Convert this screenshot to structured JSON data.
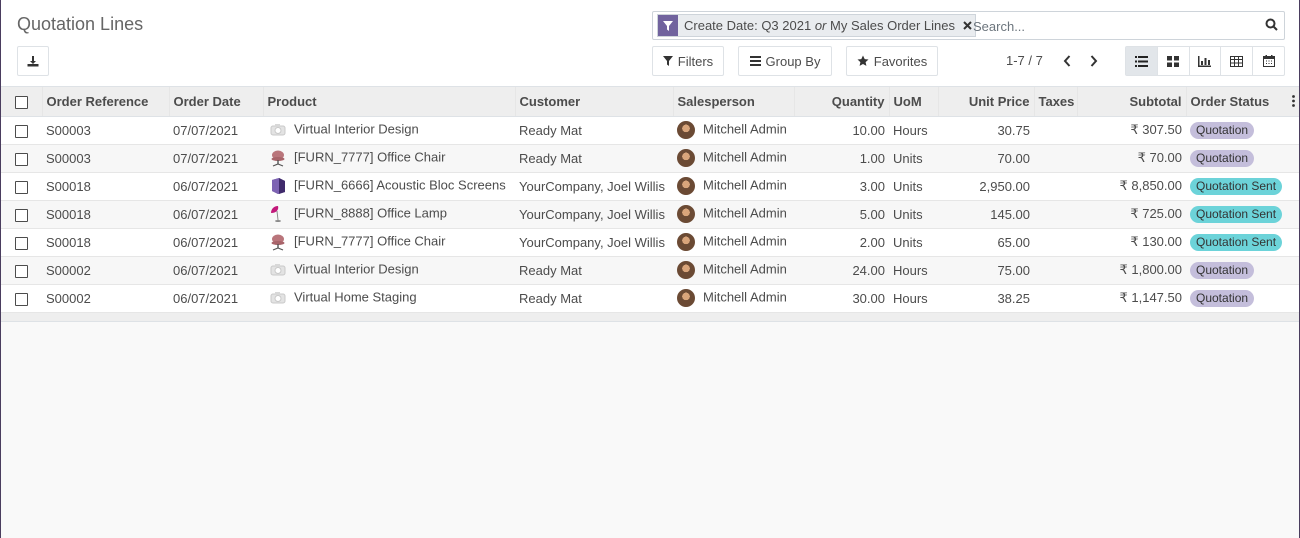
{
  "page": {
    "title": "Quotation Lines"
  },
  "search": {
    "facet": {
      "text_a": "Create Date: Q3 2021",
      "or_word": "or",
      "text_b": "My Sales Order Lines"
    },
    "placeholder": "Search..."
  },
  "toolbar": {
    "filters_label": "Filters",
    "group_by_label": "Group By",
    "favorites_label": "Favorites"
  },
  "pager": {
    "value": "1-7 / 7"
  },
  "views": [
    "list-icon",
    "kanban-icon",
    "graph-icon",
    "pivot-icon",
    "calendar-icon"
  ],
  "table": {
    "columns": {
      "order_reference": "Order Reference",
      "order_date": "Order Date",
      "product": "Product",
      "customer": "Customer",
      "salesperson": "Salesperson",
      "quantity": "Quantity",
      "uom": "UoM",
      "unit_price": "Unit Price",
      "taxes": "Taxes",
      "subtotal": "Subtotal",
      "order_status": "Order Status"
    },
    "rows": [
      {
        "ref": "S00003",
        "date": "07/07/2021",
        "product": "Virtual Interior Design",
        "product_icon": "service-camera-icon",
        "customer": "Ready Mat",
        "salesperson": "Mitchell Admin",
        "qty": "10.00",
        "uom": "Hours",
        "price": "30.75",
        "taxes": "",
        "subtotal": "₹ 307.50",
        "status": "Quotation",
        "status_kind": "quotation"
      },
      {
        "ref": "S00003",
        "date": "07/07/2021",
        "product": "[FURN_7777] Office Chair",
        "product_icon": "office-chair-icon",
        "customer": "Ready Mat",
        "salesperson": "Mitchell Admin",
        "qty": "1.00",
        "uom": "Units",
        "price": "70.00",
        "taxes": "",
        "subtotal": "₹ 70.00",
        "status": "Quotation",
        "status_kind": "quotation"
      },
      {
        "ref": "S00018",
        "date": "06/07/2021",
        "product": "[FURN_6666] Acoustic Bloc Screens",
        "product_icon": "acoustic-screen-icon",
        "customer": "YourCompany, Joel Willis",
        "salesperson": "Mitchell Admin",
        "qty": "3.00",
        "uom": "Units",
        "price": "2,950.00",
        "taxes": "",
        "subtotal": "₹ 8,850.00",
        "status": "Quotation Sent",
        "status_kind": "sent"
      },
      {
        "ref": "S00018",
        "date": "06/07/2021",
        "product": "[FURN_8888] Office Lamp",
        "product_icon": "office-lamp-icon",
        "customer": "YourCompany, Joel Willis",
        "salesperson": "Mitchell Admin",
        "qty": "5.00",
        "uom": "Units",
        "price": "145.00",
        "taxes": "",
        "subtotal": "₹ 725.00",
        "status": "Quotation Sent",
        "status_kind": "sent"
      },
      {
        "ref": "S00018",
        "date": "06/07/2021",
        "product": "[FURN_7777] Office Chair",
        "product_icon": "office-chair-icon",
        "customer": "YourCompany, Joel Willis",
        "salesperson": "Mitchell Admin",
        "qty": "2.00",
        "uom": "Units",
        "price": "65.00",
        "taxes": "",
        "subtotal": "₹ 130.00",
        "status": "Quotation Sent",
        "status_kind": "sent"
      },
      {
        "ref": "S00002",
        "date": "06/07/2021",
        "product": "Virtual Interior Design",
        "product_icon": "service-camera-icon",
        "customer": "Ready Mat",
        "salesperson": "Mitchell Admin",
        "qty": "24.00",
        "uom": "Hours",
        "price": "75.00",
        "taxes": "",
        "subtotal": "₹ 1,800.00",
        "status": "Quotation",
        "status_kind": "quotation"
      },
      {
        "ref": "S00002",
        "date": "06/07/2021",
        "product": "Virtual Home Staging",
        "product_icon": "service-camera-icon",
        "customer": "Ready Mat",
        "salesperson": "Mitchell Admin",
        "qty": "30.00",
        "uom": "Hours",
        "price": "38.25",
        "taxes": "",
        "subtotal": "₹ 1,147.50",
        "status": "Quotation",
        "status_kind": "quotation"
      }
    ]
  },
  "colors": {
    "facet_accent": "#71639e",
    "badge_quotation": "#c4bedb",
    "badge_sent": "#6cd3d9"
  }
}
